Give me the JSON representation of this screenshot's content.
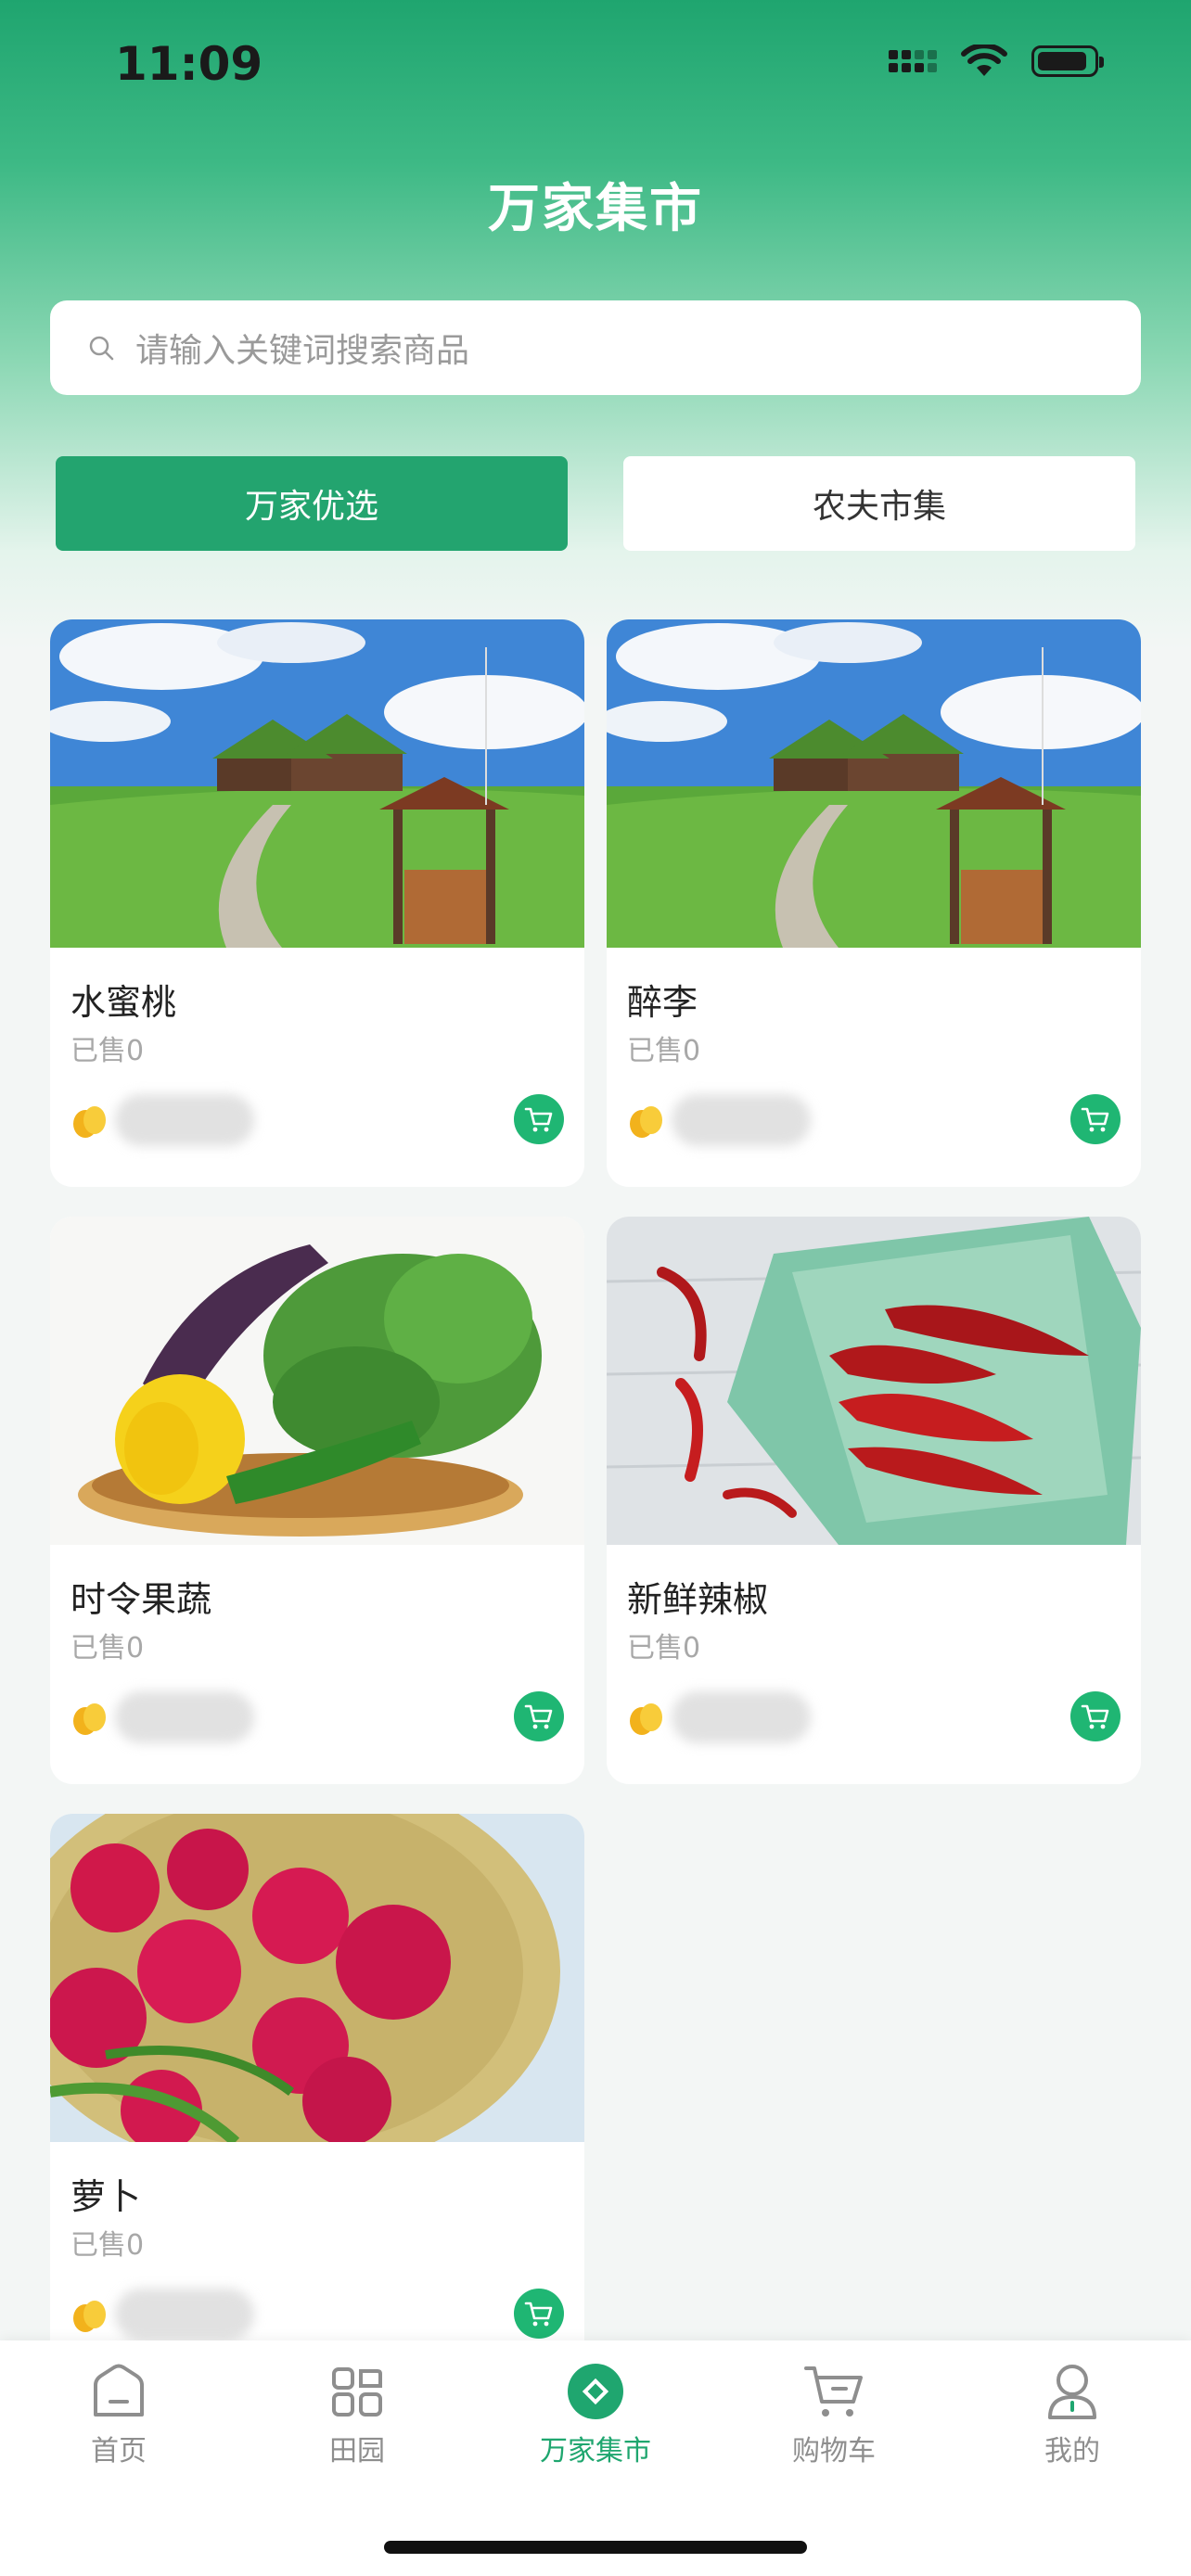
{
  "status_bar": {
    "time": "11:09"
  },
  "header": {
    "title": "万家集市"
  },
  "search": {
    "placeholder": "请输入关键词搜索商品"
  },
  "tabs": [
    {
      "label": "万家优选",
      "active": true
    },
    {
      "label": "农夫市集",
      "active": false
    }
  ],
  "products": [
    {
      "name": "水蜜桃",
      "sold": "已售0",
      "image": "farm-house-landscape"
    },
    {
      "name": "醉李",
      "sold": "已售0",
      "image": "farm-house-landscape"
    },
    {
      "name": "时令果蔬",
      "sold": "已售0",
      "image": "vegetable-basket"
    },
    {
      "name": "新鲜辣椒",
      "sold": "已售0",
      "image": "red-chili-peppers"
    },
    {
      "name": "萝卜",
      "sold": "已售0",
      "image": "radishes-basket"
    }
  ],
  "tabbar": {
    "items": [
      {
        "label": "首页",
        "icon": "home-icon",
        "active": false
      },
      {
        "label": "田园",
        "icon": "grid-icon",
        "active": false
      },
      {
        "label": "万家集市",
        "icon": "market-icon",
        "active": true
      },
      {
        "label": "购物车",
        "icon": "cart-icon",
        "active": false
      },
      {
        "label": "我的",
        "icon": "user-icon",
        "active": false
      }
    ]
  },
  "colors": {
    "accent": "#23a46f",
    "cart_button": "#1fb673",
    "background": "#f3f6f5"
  }
}
